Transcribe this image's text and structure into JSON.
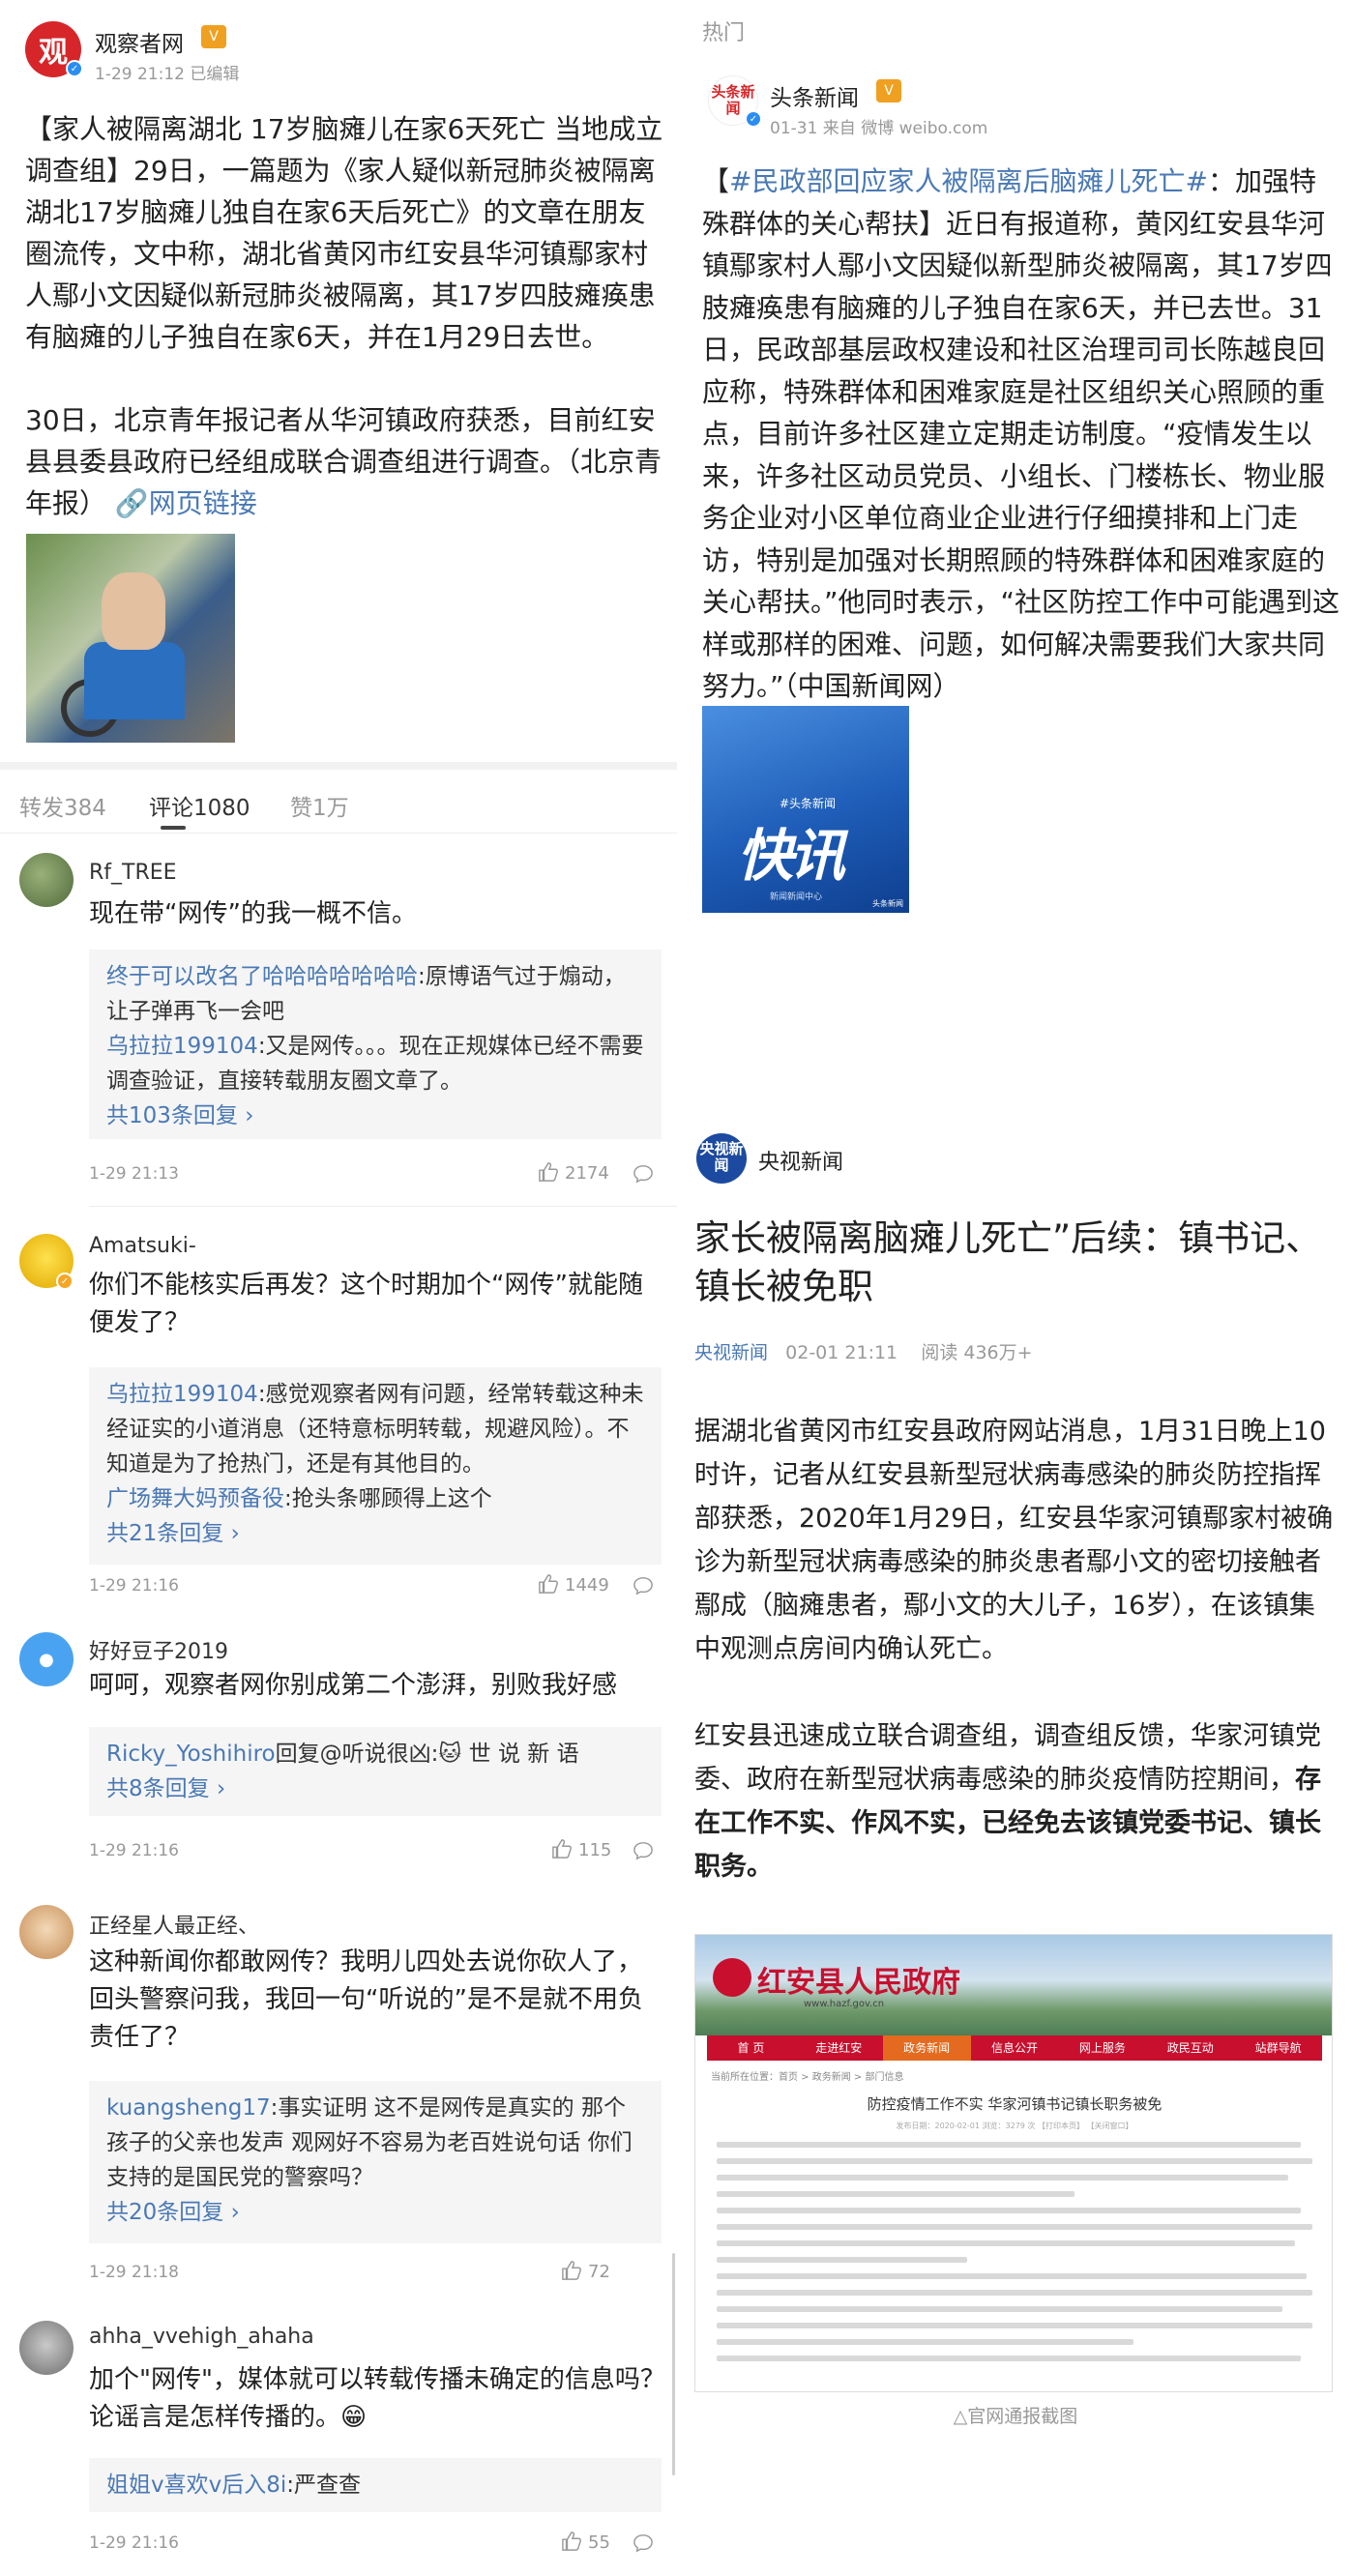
{
  "left": {
    "post": {
      "author": "观察者网",
      "vip_badge": "V",
      "time": "1-29 21:12 已编辑",
      "paragraph1": "【家人被隔离湖北 17岁脑瘫儿在家6天死亡 当地成立调查组】29日，一篇题为《家人疑似新冠肺炎被隔离湖北17岁脑瘫儿独自在家6天后死亡》的文章在朋友圈流传，文中称，湖北省黄冈市红安县华河镇鄢家村人鄢小文因疑似新冠肺炎被隔离，其17岁四肢瘫痪患有脑瘫的儿子独自在家6天，并在1月29日去世。",
      "paragraph2": "30日，北京青年报记者从华河镇政府获悉，目前红安县县委县政府已经组成联合调查组进行调查。（北京青年报）",
      "link_label": "网页链接"
    },
    "tabs": {
      "repost": "转发384",
      "comments": "评论1080",
      "likes": "赞1万"
    },
    "comments": [
      {
        "name": "Rf_TREE",
        "text": "现在带“网传”的我一概不信。",
        "replies": [
          {
            "user": "终于可以改名了哈哈哈哈哈哈哈",
            "text": ":原博语气过于煽动，让子弹再飞一会吧"
          },
          {
            "user": "乌拉拉199104",
            "text": ":又是网传。。。现在正规媒体已经不需要调查验证，直接转载朋友圈文章了。"
          }
        ],
        "more": "共103条回复 ›",
        "time": "1-29 21:13",
        "likes": "2174"
      },
      {
        "name": "Amatsuki-",
        "text": "你们不能核实后再发？这个时期加个“网传”就能随便发了？",
        "replies": [
          {
            "user": "乌拉拉199104",
            "text": ":感觉观察者网有问题，经常转载这种未经证实的小道消息（还特意标明转载，规避风险）。不知道是为了抢热门，还是有其他目的。"
          },
          {
            "user": "广场舞大妈预备役",
            "text": ":抢头条哪顾得上这个"
          }
        ],
        "more": "共21条回复 ›",
        "time": "1-29 21:16",
        "likes": "1449"
      },
      {
        "name": "好好豆子2019",
        "text": "呵呵，观察者网你别成第二个澎湃，别败我好感",
        "replies": [
          {
            "user": "Ricky_Yoshihiro",
            "text": "回复@听说很凶:🐱 世 说 新 语"
          }
        ],
        "more": "共8条回复 ›",
        "time": "1-29 21:16",
        "likes": "115"
      },
      {
        "name": "正经星人最正经、",
        "text": "这种新闻你都敢网传？我明儿四处去说你砍人了，回头警察问我，我回一句“听说的”是不是就不用负责任了？",
        "replies": [
          {
            "user": "kuangsheng17",
            "text": ":事实证明 这不是网传是真实的 那个孩子的父亲也发声 观网好不容易为老百姓说句话 你们支持的是国民党的警察吗？"
          }
        ],
        "more": "共20条回复 ›",
        "time": "1-29 21:18",
        "likes": "72"
      },
      {
        "name": "ahha_vvehigh_ahaha",
        "text": "加个\"网传\"，媒体就可以转载传播未确定的信息吗？论谣言是怎样传播的。😁",
        "replies": [
          {
            "user": "姐姐v喜欢v后入8i",
            "text": ":严查查"
          }
        ],
        "more": "",
        "time": "1-29 21:16",
        "likes": "55"
      }
    ]
  },
  "right": {
    "hot_label": "热门",
    "toutiao": {
      "logo_text": "头条新闻",
      "author": "头条新闻",
      "vip_badge": "V",
      "time": "01-31 来自 微博 weibo.com",
      "topic": "#民政部回应家人被隔离后脑瘫儿死亡#",
      "body": "：加强特殊群体的关心帮扶】近日有报道称，黄冈红安县华河镇鄢家村人鄢小文因疑似新型肺炎被隔离，其17岁四肢瘫痪患有脑瘫的儿子独自在家6天，并已去世。31日，民政部基层政权建设和社区治理司司长陈越良回应称，特殊群体和困难家庭是社区组织关心照顾的重点，目前许多社区建立定期走访制度。“疫情发生以来，许多社区动员党员、小组长、门楼栋长、物业服务企业对小区单位商业企业进行仔细摸排和上门走访，特别是加强对长期照顾的特殊群体和困难家庭的关心帮扶。”他同时表示，“社区防控工作中可能遇到这样或那样的困难、问题，如何解决需要我们大家共同努力。”（中国新闻网）",
      "open_bracket": "【",
      "image": {
        "tag": "#头条新闻",
        "big": "快讯",
        "foot": "新闻新闻中心",
        "brand": "头条新闻"
      }
    },
    "cctv": {
      "logo_text": "央视新闻",
      "author": "央视新闻",
      "title": "家长被隔离脑瘫儿死亡”后续：镇书记、镇长被免职",
      "meta_source": "央视新闻",
      "meta_time": "02-01 21:11",
      "meta_reads": "阅读 436万+",
      "paragraph1": "据湖北省黄冈市红安县政府网站消息，1月31日晚上10时许，记者从红安县新型冠状病毒感染的肺炎防控指挥部获悉，2020年1月29日，红安县华家河镇鄢家村被确诊为新型冠状病毒感染的肺炎患者鄢小文的密切接触者鄢成（脑瘫患者，鄢小文的大儿子，16岁），在该镇集中观测点房间内确认死亡。",
      "paragraph2_a": "红安县迅速成立联合调查组，调查组反馈，华家河镇党委、政府在新型冠状病毒感染的肺炎疫情防控期间，",
      "paragraph2_b": "存在工作不实、作风不实，已经免去该镇党委书记、镇长职务。",
      "gov": {
        "site_name": "红安县人民政府",
        "url": "www.hazf.gov.cn",
        "nav": [
          "首 页",
          "走进红安",
          "政务新闻",
          "信息公开",
          "网上服务",
          "政民互动",
          "站群导航"
        ],
        "crumb": "当前所在位置：首页 > 政务新闻 > 部门信息",
        "title": "防控疫情工作不实 华家河镇书记镇长职务被免",
        "info": "发布日期：2020-02-01   浏览：3279 次   【打印本页】   【关闭窗口】"
      },
      "caption": "△官网通报截图"
    }
  }
}
